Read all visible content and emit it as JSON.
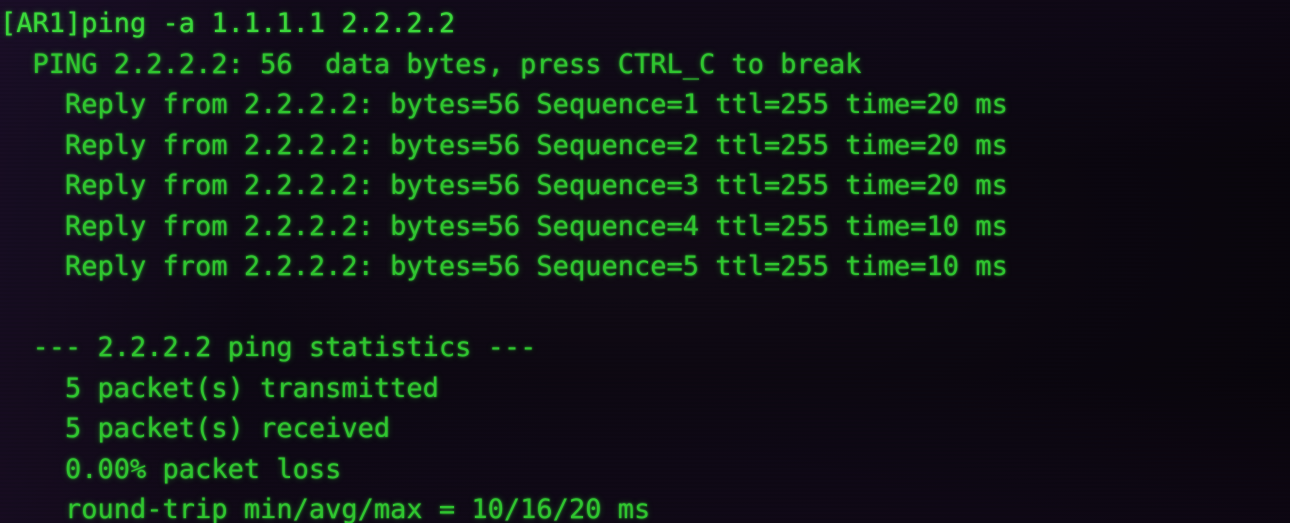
{
  "terminal": {
    "prompt": "[AR1]",
    "command": "ping -a 1.1.1.1 2.2.2.2",
    "foreground_color": "#2fc62f",
    "background_color": "#0b0710",
    "ping": {
      "target": "2.2.2.2",
      "source": "1.1.1.1",
      "data_bytes": 56,
      "break_hint": "press CTRL_C to break",
      "header": "  PING 2.2.2.2: 56  data bytes, press CTRL_C to break",
      "replies": [
        "    Reply from 2.2.2.2: bytes=56 Sequence=1 ttl=255 time=20 ms",
        "    Reply from 2.2.2.2: bytes=56 Sequence=2 ttl=255 time=20 ms",
        "    Reply from 2.2.2.2: bytes=56 Sequence=3 ttl=255 time=20 ms",
        "    Reply from 2.2.2.2: bytes=56 Sequence=4 ttl=255 time=10 ms",
        "    Reply from 2.2.2.2: bytes=56 Sequence=5 ttl=255 time=10 ms"
      ],
      "reply_rows": [
        {
          "sequence": 1,
          "bytes": 56,
          "ttl": 255,
          "time_ms": 20
        },
        {
          "sequence": 2,
          "bytes": 56,
          "ttl": 255,
          "time_ms": 20
        },
        {
          "sequence": 3,
          "bytes": 56,
          "ttl": 255,
          "time_ms": 20
        },
        {
          "sequence": 4,
          "bytes": 56,
          "ttl": 255,
          "time_ms": 10
        },
        {
          "sequence": 5,
          "bytes": 56,
          "ttl": 255,
          "time_ms": 10
        }
      ],
      "statistics_header": "  --- 2.2.2.2 ping statistics ---",
      "statistics": [
        "    5 packet(s) transmitted",
        "    5 packet(s) received",
        "    0.00% packet loss",
        "    round-trip min/avg/max = 10/16/20 ms"
      ],
      "statistics_values": {
        "transmitted": 5,
        "received": 5,
        "packet_loss": "0.00%",
        "rtt_min_ms": 10,
        "rtt_avg_ms": 16,
        "rtt_max_ms": 20
      }
    },
    "lines": [
      "[AR1]ping -a 1.1.1.1 2.2.2.2",
      "  PING 2.2.2.2: 56  data bytes, press CTRL_C to break",
      "    Reply from 2.2.2.2: bytes=56 Sequence=1 ttl=255 time=20 ms",
      "    Reply from 2.2.2.2: bytes=56 Sequence=2 ttl=255 time=20 ms",
      "    Reply from 2.2.2.2: bytes=56 Sequence=3 ttl=255 time=20 ms",
      "    Reply from 2.2.2.2: bytes=56 Sequence=4 ttl=255 time=10 ms",
      "    Reply from 2.2.2.2: bytes=56 Sequence=5 ttl=255 time=10 ms",
      " ",
      "  --- 2.2.2.2 ping statistics ---",
      "    5 packet(s) transmitted",
      "    5 packet(s) received",
      "    0.00% packet loss",
      "    round-trip min/avg/max = 10/16/20 ms"
    ]
  }
}
